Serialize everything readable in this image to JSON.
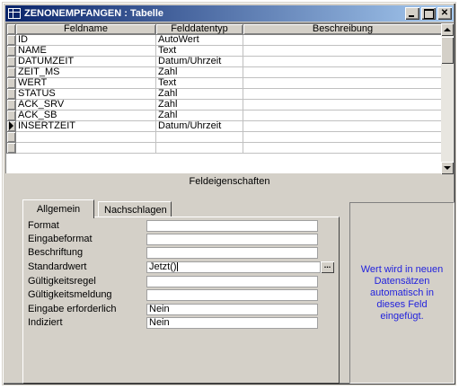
{
  "window": {
    "title": "ZENONEMPFANGEN : Tabelle"
  },
  "grid": {
    "columns": [
      "Feldname",
      "Felddatentyp",
      "Beschreibung"
    ],
    "rows": [
      {
        "name": "ID",
        "type": "AutoWert",
        "desc": ""
      },
      {
        "name": "NAME",
        "type": "Text",
        "desc": ""
      },
      {
        "name": "DATUMZEIT",
        "type": "Datum/Uhrzeit",
        "desc": ""
      },
      {
        "name": "ZEIT_MS",
        "type": "Zahl",
        "desc": ""
      },
      {
        "name": "WERT",
        "type": "Text",
        "desc": ""
      },
      {
        "name": "STATUS",
        "type": "Zahl",
        "desc": ""
      },
      {
        "name": "ACK_SRV",
        "type": "Zahl",
        "desc": ""
      },
      {
        "name": "ACK_SB",
        "type": "Zahl",
        "desc": ""
      },
      {
        "name": "INSERTZEIT",
        "type": "Datum/Uhrzeit",
        "desc": ""
      },
      {
        "name": "",
        "type": "",
        "desc": ""
      },
      {
        "name": "",
        "type": "",
        "desc": ""
      }
    ]
  },
  "properties": {
    "section_label": "Feldeigenschaften",
    "tabs": [
      "Allgemein",
      "Nachschlagen"
    ],
    "fields": [
      {
        "label": "Format",
        "value": ""
      },
      {
        "label": "Eingabeformat",
        "value": ""
      },
      {
        "label": "Beschriftung",
        "value": ""
      },
      {
        "label": "Standardwert",
        "value": "Jetzt()"
      },
      {
        "label": "Gültigkeitsregel",
        "value": ""
      },
      {
        "label": "Gültigkeitsmeldung",
        "value": ""
      },
      {
        "label": "Eingabe erforderlich",
        "value": "Nein"
      },
      {
        "label": "Indiziert",
        "value": "Nein"
      }
    ],
    "build_button": "...",
    "hint": "Wert wird in neuen Datensätzen automatisch in dieses Feld eingefügt."
  },
  "colors": {
    "titlebar_start": "#0a246a",
    "titlebar_end": "#a6caf0",
    "hint_text": "#2222dd",
    "face": "#d4d0c8"
  }
}
